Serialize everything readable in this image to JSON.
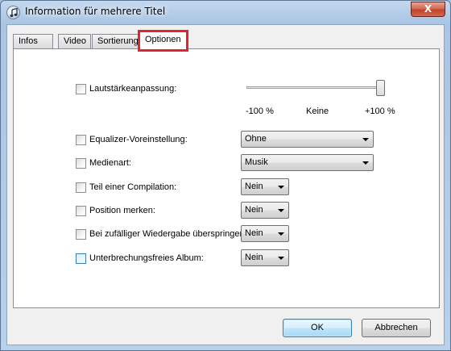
{
  "window": {
    "title": "Information für mehrere Titel",
    "close_label": "X"
  },
  "tabs": [
    {
      "label": "Infos",
      "active": false
    },
    {
      "label": "Video",
      "active": false
    },
    {
      "label": "Sortierung",
      "active": false
    },
    {
      "label": "Optionen",
      "active": true
    }
  ],
  "options": {
    "volume": {
      "label": "Lautstärkeanpassung:",
      "checked": false,
      "slider_level_percent": 100,
      "min_label": "-100 %",
      "mid_label": "Keine",
      "max_label": "+100 %"
    },
    "equalizer": {
      "label": "Equalizer-Voreinstellung:",
      "checked": false,
      "value": "Ohne"
    },
    "media_type": {
      "label": "Medienart:",
      "checked": false,
      "value": "Musik"
    },
    "compilation": {
      "label": "Teil einer Compilation:",
      "checked": false,
      "value": "Nein"
    },
    "remember_position": {
      "label": "Position merken:",
      "checked": false,
      "value": "Nein"
    },
    "skip_shuffle": {
      "label": "Bei zufälliger Wiedergabe überspringen:",
      "checked": false,
      "value": "Nein"
    },
    "gapless": {
      "label": "Unterbrechungsfreies Album:",
      "checked": false,
      "value": "Nein"
    }
  },
  "buttons": {
    "ok": "OK",
    "cancel": "Abbrechen"
  },
  "colors": {
    "highlight": "#e2252b",
    "title_bar": "#a9c5e3",
    "close_button": "#c0432b"
  }
}
